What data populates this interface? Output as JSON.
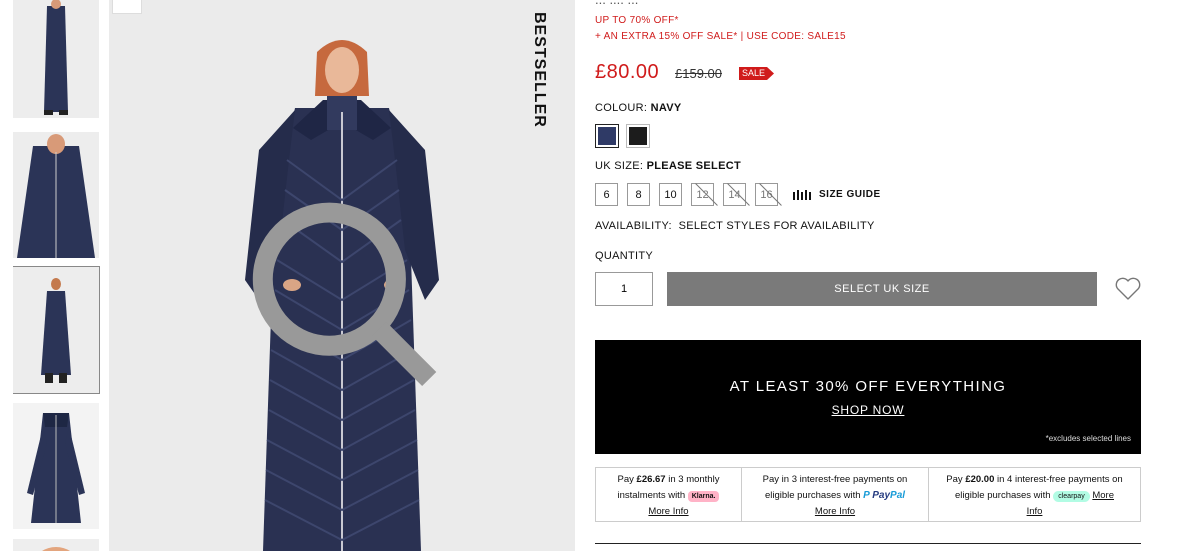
{
  "product": {
    "partial_title": "... .... ..."
  },
  "badge": "BESTSELLER",
  "promo": {
    "line1": "UP TO 70% OFF*",
    "line2": "+ AN EXTRA 15% OFF SALE* | USE CODE: SALE15"
  },
  "price": {
    "current": "£80.00",
    "original": "£159.00",
    "tag": "SALE"
  },
  "colour": {
    "label": "COLOUR:",
    "selected": "NAVY",
    "swatches": [
      {
        "name": "Navy",
        "color": "#2f3a66",
        "selected": true
      },
      {
        "name": "Black",
        "color": "#1c1c1c",
        "selected": false
      }
    ]
  },
  "size": {
    "label": "UK SIZE:",
    "prompt": "PLEASE SELECT",
    "options": [
      {
        "value": "6",
        "available": true
      },
      {
        "value": "8",
        "available": true
      },
      {
        "value": "10",
        "available": true
      },
      {
        "value": "12",
        "available": false
      },
      {
        "value": "14",
        "available": false
      },
      {
        "value": "16",
        "available": false
      }
    ],
    "guide": "SIZE GUIDE"
  },
  "availability": {
    "label": "AVAILABILITY:",
    "value": "SELECT STYLES FOR AVAILABILITY"
  },
  "quantity": {
    "label": "QUANTITY",
    "value": "1"
  },
  "cta": {
    "label": "SELECT UK SIZE"
  },
  "banner": {
    "headline": "AT LEAST 30% OFF EVERYTHING",
    "link": "SHOP NOW",
    "note": "*excludes selected lines"
  },
  "payments": {
    "klarna": {
      "pre": "Pay ",
      "amount": "£26.67",
      "mid": " in 3 monthly",
      "line2": "instalments with ",
      "brand": "Klarna.",
      "link": "More Info"
    },
    "paypal": {
      "line1": "Pay in 3 interest-free payments on",
      "line2": "eligible purchases with ",
      "brand_a": "Pay",
      "brand_b": "Pal",
      "link": "More Info"
    },
    "clearpay": {
      "pre": "Pay ",
      "amount": "£20.00",
      "mid": " in 4 interest-free payments on",
      "line2": "eligible purchases with ",
      "brand": "clearpay",
      "link_a": "More",
      "link_b": "Info"
    }
  },
  "icons": {
    "wishlist": "heart-icon",
    "zoom": "magnify-icon",
    "size_guide": "ruler-bars-icon"
  },
  "colors": {
    "sale_red": "#d01b1b",
    "cta_grey": "#7a7a7a",
    "banner_bg": "#000000"
  }
}
